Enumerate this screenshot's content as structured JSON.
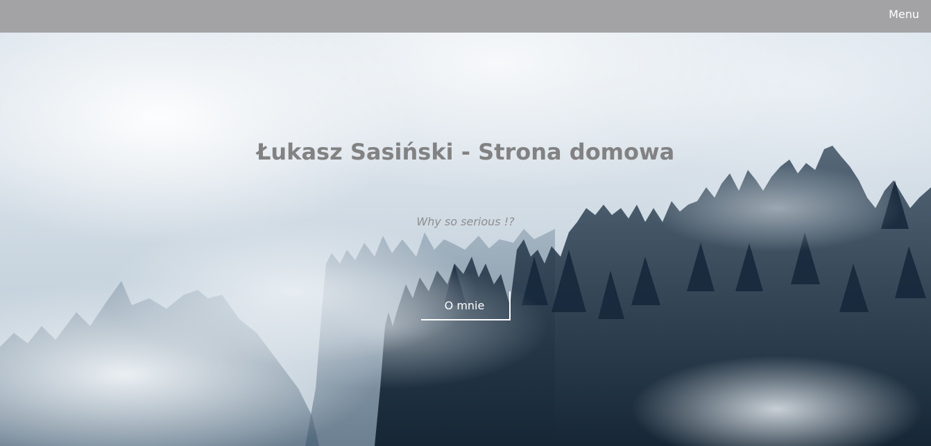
{
  "navbar": {
    "menu_label": "Menu"
  },
  "hero": {
    "title": "Łukasz Sasiński - Strona domowa",
    "subtitle": "Why so serious !?",
    "cta_label": "O mnie"
  },
  "colors": {
    "navbar_bg": "#a3a2a5",
    "title_text": "#828282",
    "subtitle_text": "#8e8e8e",
    "button_border": "#ffffff"
  }
}
